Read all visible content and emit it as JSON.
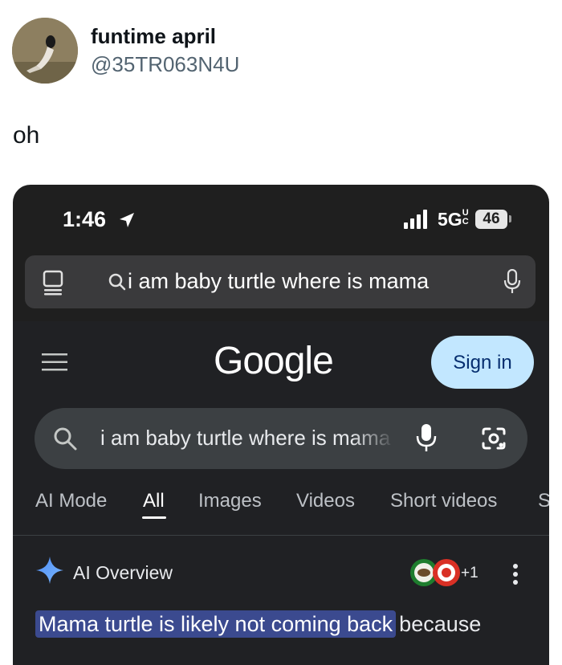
{
  "tweet": {
    "name": "funtime april",
    "handle": "@35TR063N4U",
    "text": "oh"
  },
  "status_bar": {
    "time": "1:46",
    "network": "5G",
    "network_suffix": "UC",
    "battery": "46"
  },
  "browser": {
    "url_text": "i am baby turtle where is mama"
  },
  "google": {
    "logo": "Google",
    "sign_in": "Sign in",
    "search_value": "i am baby turtle where is mama",
    "tabs": [
      {
        "label": "AI Mode",
        "active": false
      },
      {
        "label": "All",
        "active": true
      },
      {
        "label": "Images",
        "active": false
      },
      {
        "label": "Videos",
        "active": false
      },
      {
        "label": "Short videos",
        "active": false
      },
      {
        "label": "S",
        "active": false
      }
    ],
    "ai_overview": {
      "title": "AI Overview",
      "sources_more": "+1",
      "answer_highlight": "Mama turtle is likely not coming back",
      "answer_rest": "because"
    }
  },
  "colors": {
    "phone_bg": "#1f1f1f",
    "page_bg": "#202124",
    "sign_in_bg": "#c2e7ff",
    "highlight": "#3b4a8f"
  }
}
